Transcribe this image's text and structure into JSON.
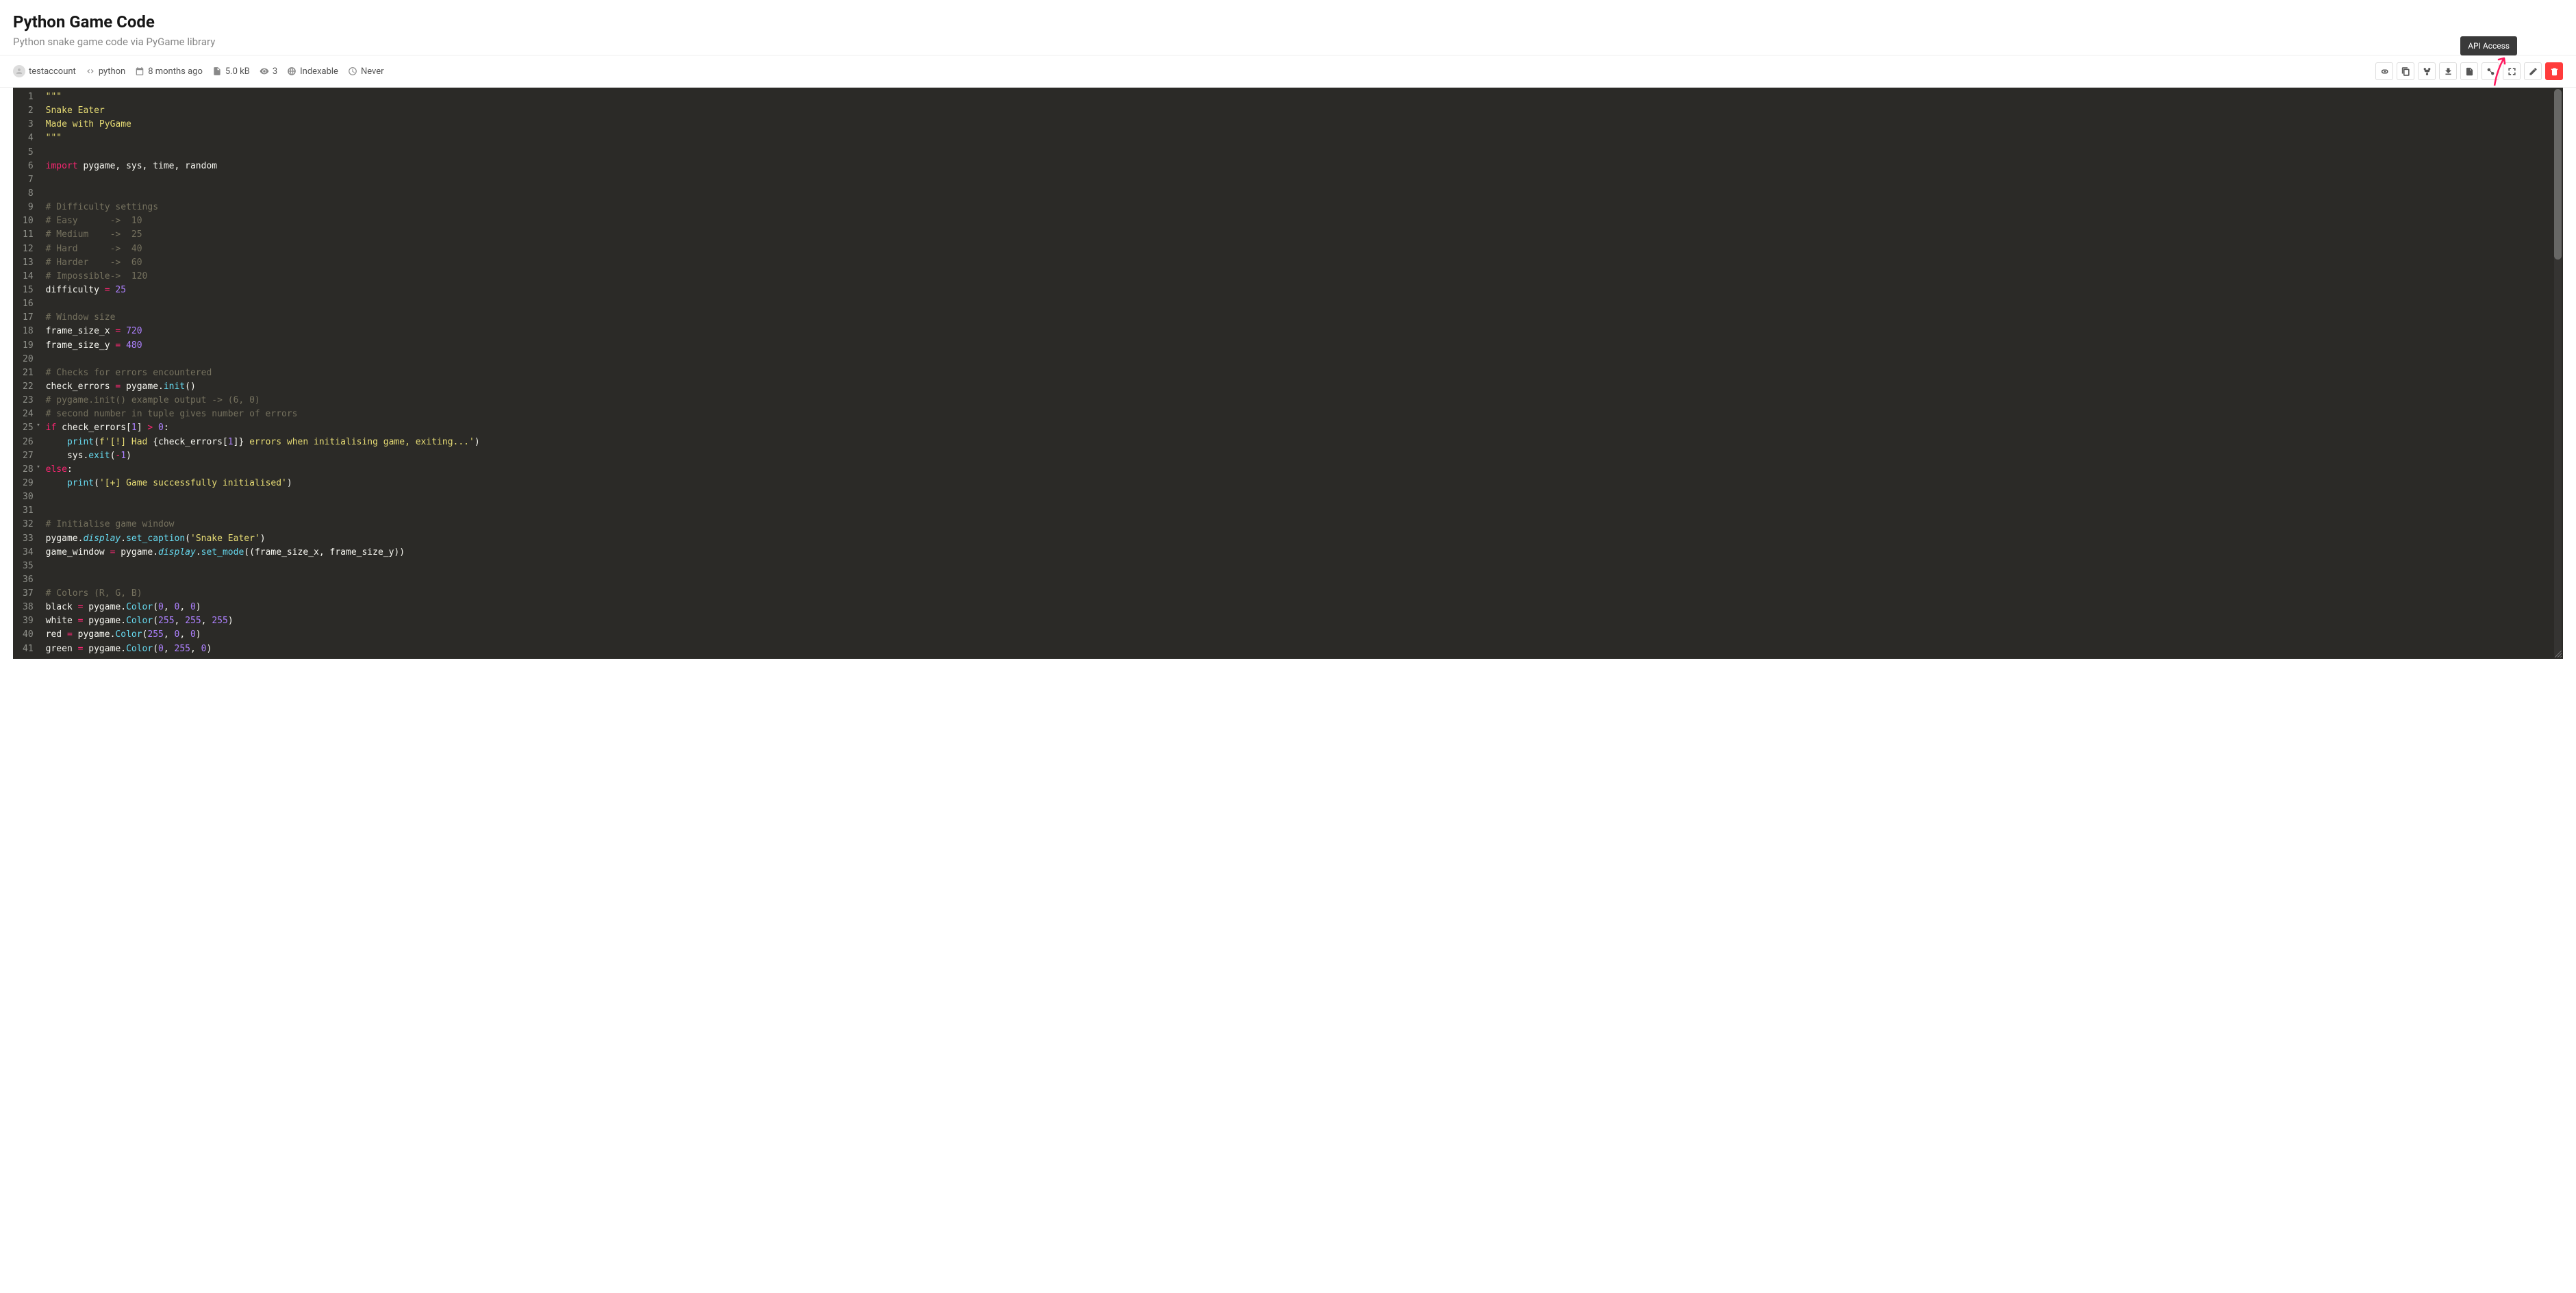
{
  "header": {
    "title": "Python Game Code",
    "subtitle": "Python snake game code via PyGame library"
  },
  "meta": {
    "user": "testaccount",
    "language": "python",
    "age": "8 months ago",
    "size": "5.0 kB",
    "views": "3",
    "index_status": "Indexable",
    "expiry": "Never"
  },
  "tooltip": "API Access",
  "code_lines": [
    [
      {
        "t": "\"\"\"",
        "c": "c-str"
      }
    ],
    [
      {
        "t": "Snake Eater",
        "c": "c-str"
      }
    ],
    [
      {
        "t": "Made with PyGame",
        "c": "c-str"
      }
    ],
    [
      {
        "t": "\"\"\"",
        "c": "c-str"
      }
    ],
    [],
    [
      {
        "t": "import",
        "c": "c-kw"
      },
      {
        "t": " pygame, sys, time, random",
        "c": ""
      }
    ],
    [],
    [],
    [
      {
        "t": "# Difficulty settings",
        "c": "c-cmt"
      }
    ],
    [
      {
        "t": "# Easy      ->  10",
        "c": "c-cmt"
      }
    ],
    [
      {
        "t": "# Medium    ->  25",
        "c": "c-cmt"
      }
    ],
    [
      {
        "t": "# Hard      ->  40",
        "c": "c-cmt"
      }
    ],
    [
      {
        "t": "# Harder    ->  60",
        "c": "c-cmt"
      }
    ],
    [
      {
        "t": "# Impossible->  120",
        "c": "c-cmt"
      }
    ],
    [
      {
        "t": "difficulty ",
        "c": ""
      },
      {
        "t": "=",
        "c": "c-op"
      },
      {
        "t": " ",
        "c": ""
      },
      {
        "t": "25",
        "c": "c-num"
      }
    ],
    [],
    [
      {
        "t": "# Window size",
        "c": "c-cmt"
      }
    ],
    [
      {
        "t": "frame_size_x ",
        "c": ""
      },
      {
        "t": "=",
        "c": "c-op"
      },
      {
        "t": " ",
        "c": ""
      },
      {
        "t": "720",
        "c": "c-num"
      }
    ],
    [
      {
        "t": "frame_size_y ",
        "c": ""
      },
      {
        "t": "=",
        "c": "c-op"
      },
      {
        "t": " ",
        "c": ""
      },
      {
        "t": "480",
        "c": "c-num"
      }
    ],
    [],
    [
      {
        "t": "# Checks for errors encountered",
        "c": "c-cmt"
      }
    ],
    [
      {
        "t": "check_errors ",
        "c": ""
      },
      {
        "t": "=",
        "c": "c-op"
      },
      {
        "t": " pygame.",
        "c": ""
      },
      {
        "t": "init",
        "c": "c-fn"
      },
      {
        "t": "()",
        "c": ""
      }
    ],
    [
      {
        "t": "# pygame.init() example output -> (6, 0)",
        "c": "c-cmt"
      }
    ],
    [
      {
        "t": "# second number in tuple gives number of errors",
        "c": "c-cmt"
      }
    ],
    [
      {
        "t": "if",
        "c": "c-kw"
      },
      {
        "t": " check_errors[",
        "c": ""
      },
      {
        "t": "1",
        "c": "c-num"
      },
      {
        "t": "] ",
        "c": ""
      },
      {
        "t": ">",
        "c": "c-op"
      },
      {
        "t": " ",
        "c": ""
      },
      {
        "t": "0",
        "c": "c-num"
      },
      {
        "t": ":",
        "c": ""
      }
    ],
    [
      {
        "t": "    ",
        "c": ""
      },
      {
        "t": "print",
        "c": "c-fn"
      },
      {
        "t": "(",
        "c": ""
      },
      {
        "t": "f'[!] Had ",
        "c": "c-str"
      },
      {
        "t": "{check_errors[",
        "c": ""
      },
      {
        "t": "1",
        "c": "c-num"
      },
      {
        "t": "]}",
        "c": ""
      },
      {
        "t": " errors when initialising game, exiting...'",
        "c": "c-str"
      },
      {
        "t": ")",
        "c": ""
      }
    ],
    [
      {
        "t": "    sys.",
        "c": ""
      },
      {
        "t": "exit",
        "c": "c-fn"
      },
      {
        "t": "(",
        "c": ""
      },
      {
        "t": "-",
        "c": "c-op"
      },
      {
        "t": "1",
        "c": "c-num"
      },
      {
        "t": ")",
        "c": ""
      }
    ],
    [
      {
        "t": "else",
        "c": "c-kw"
      },
      {
        "t": ":",
        "c": ""
      }
    ],
    [
      {
        "t": "    ",
        "c": ""
      },
      {
        "t": "print",
        "c": "c-fn"
      },
      {
        "t": "(",
        "c": ""
      },
      {
        "t": "'[+] Game successfully initialised'",
        "c": "c-str"
      },
      {
        "t": ")",
        "c": ""
      }
    ],
    [],
    [],
    [
      {
        "t": "# Initialise game window",
        "c": "c-cmt"
      }
    ],
    [
      {
        "t": "pygame.",
        "c": ""
      },
      {
        "t": "display",
        "c": "c-mod"
      },
      {
        "t": ".",
        "c": ""
      },
      {
        "t": "set_caption",
        "c": "c-fn"
      },
      {
        "t": "(",
        "c": ""
      },
      {
        "t": "'Snake Eater'",
        "c": "c-str"
      },
      {
        "t": ")",
        "c": ""
      }
    ],
    [
      {
        "t": "game_window ",
        "c": ""
      },
      {
        "t": "=",
        "c": "c-op"
      },
      {
        "t": " pygame.",
        "c": ""
      },
      {
        "t": "display",
        "c": "c-mod"
      },
      {
        "t": ".",
        "c": ""
      },
      {
        "t": "set_mode",
        "c": "c-fn"
      },
      {
        "t": "((frame_size_x, frame_size_y))",
        "c": ""
      }
    ],
    [],
    [],
    [
      {
        "t": "# Colors (R, G, B)",
        "c": "c-cmt"
      }
    ],
    [
      {
        "t": "black ",
        "c": ""
      },
      {
        "t": "=",
        "c": "c-op"
      },
      {
        "t": " pygame.",
        "c": ""
      },
      {
        "t": "Color",
        "c": "c-fn"
      },
      {
        "t": "(",
        "c": ""
      },
      {
        "t": "0",
        "c": "c-num"
      },
      {
        "t": ", ",
        "c": ""
      },
      {
        "t": "0",
        "c": "c-num"
      },
      {
        "t": ", ",
        "c": ""
      },
      {
        "t": "0",
        "c": "c-num"
      },
      {
        "t": ")",
        "c": ""
      }
    ],
    [
      {
        "t": "white ",
        "c": ""
      },
      {
        "t": "=",
        "c": "c-op"
      },
      {
        "t": " pygame.",
        "c": ""
      },
      {
        "t": "Color",
        "c": "c-fn"
      },
      {
        "t": "(",
        "c": ""
      },
      {
        "t": "255",
        "c": "c-num"
      },
      {
        "t": ", ",
        "c": ""
      },
      {
        "t": "255",
        "c": "c-num"
      },
      {
        "t": ", ",
        "c": ""
      },
      {
        "t": "255",
        "c": "c-num"
      },
      {
        "t": ")",
        "c": ""
      }
    ],
    [
      {
        "t": "red ",
        "c": ""
      },
      {
        "t": "=",
        "c": "c-op"
      },
      {
        "t": " pygame.",
        "c": ""
      },
      {
        "t": "Color",
        "c": "c-fn"
      },
      {
        "t": "(",
        "c": ""
      },
      {
        "t": "255",
        "c": "c-num"
      },
      {
        "t": ", ",
        "c": ""
      },
      {
        "t": "0",
        "c": "c-num"
      },
      {
        "t": ", ",
        "c": ""
      },
      {
        "t": "0",
        "c": "c-num"
      },
      {
        "t": ")",
        "c": ""
      }
    ],
    [
      {
        "t": "green ",
        "c": ""
      },
      {
        "t": "=",
        "c": "c-op"
      },
      {
        "t": " pygame.",
        "c": ""
      },
      {
        "t": "Color",
        "c": "c-fn"
      },
      {
        "t": "(",
        "c": ""
      },
      {
        "t": "0",
        "c": "c-num"
      },
      {
        "t": ", ",
        "c": ""
      },
      {
        "t": "255",
        "c": "c-num"
      },
      {
        "t": ", ",
        "c": ""
      },
      {
        "t": "0",
        "c": "c-num"
      },
      {
        "t": ")",
        "c": ""
      }
    ]
  ],
  "fold_lines": [
    25,
    28
  ]
}
